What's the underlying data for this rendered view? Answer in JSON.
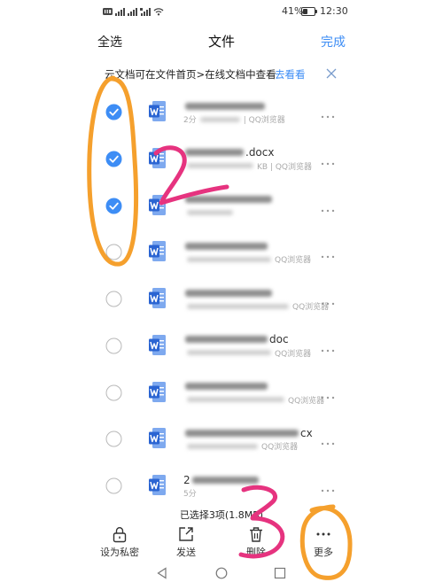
{
  "status_bar": {
    "battery_percent": "41%",
    "time": "12:30",
    "left_icons": [
      "hd-icon",
      "signal-icon",
      "signal-icon",
      "4g-signal-icon",
      "wifi-icon"
    ]
  },
  "header": {
    "select_all": "全选",
    "title": "文件",
    "done": "完成"
  },
  "banner": {
    "message": "云文档可在文件首页>在线文档中查看",
    "action": "去看看"
  },
  "files": [
    {
      "checked": true,
      "meta_prefix": "2分",
      "meta_suffix": "| QQ浏览器"
    },
    {
      "checked": true,
      "name_suffix": ".docx",
      "meta_suffix": "KB | QQ浏览器"
    },
    {
      "checked": true
    },
    {
      "checked": false,
      "meta_suffix": "QQ浏览器"
    },
    {
      "checked": false,
      "meta_suffix": "QQ浏览器"
    },
    {
      "checked": false,
      "name_suffix": "doc",
      "meta_suffix": "QQ浏览器"
    },
    {
      "checked": false,
      "meta_suffix": "QQ浏览器"
    },
    {
      "checked": false,
      "name_suffix": "cx",
      "meta_suffix": "QQ浏览器"
    },
    {
      "checked": false,
      "name_prefix": "2",
      "meta_prefix": "5分"
    }
  ],
  "selection_summary": "已选择3项(1.8MB)",
  "toolbar": [
    {
      "label": "设为私密",
      "icon": "lock-icon"
    },
    {
      "label": "发送",
      "icon": "share-icon"
    },
    {
      "label": "删除",
      "icon": "trash-icon"
    },
    {
      "label": "更多",
      "icon": "more-dots-icon"
    }
  ],
  "nav_bar": [
    "back-icon",
    "home-icon",
    "recents-icon"
  ],
  "colors": {
    "accent": "#3d8df5",
    "word_icon": "#2a64d2",
    "annotation_orange": "#f5a02d",
    "annotation_pink": "#e6337f"
  }
}
